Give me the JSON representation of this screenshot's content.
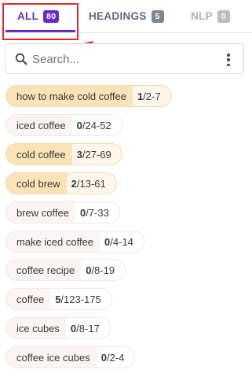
{
  "tabs": [
    {
      "label": "ALL",
      "count": "80"
    },
    {
      "label": "HEADINGS",
      "count": "5"
    },
    {
      "label": "NLP",
      "count": "0"
    }
  ],
  "search": {
    "placeholder": "Search..."
  },
  "keywords": [
    {
      "term": "how to make cold coffee",
      "used": "1",
      "range": "/2-7",
      "highlighted": true
    },
    {
      "term": "iced coffee",
      "used": "0",
      "range": "/24-52",
      "highlighted": false
    },
    {
      "term": "cold coffee",
      "used": "3",
      "range": "/27-69",
      "highlighted": true
    },
    {
      "term": "cold brew",
      "used": "2",
      "range": "/13-61",
      "highlighted": true
    },
    {
      "term": "brew coffee",
      "used": "0",
      "range": "/7-33",
      "highlighted": false
    },
    {
      "term": "make iced coffee",
      "used": "0",
      "range": "/4-14",
      "highlighted": false
    },
    {
      "term": "coffee recipe",
      "used": "0",
      "range": "/8-19",
      "highlighted": false
    },
    {
      "term": "coffee",
      "used": "5",
      "range": "/123-175",
      "highlighted": false
    },
    {
      "term": "ice cubes",
      "used": "0",
      "range": "/8-17",
      "highlighted": false
    },
    {
      "term": "coffee ice cubes",
      "used": "0",
      "range": "/2-4",
      "highlighted": false
    }
  ],
  "colors": {
    "accent": "#6a2cc4",
    "annotation": "#e02b2b",
    "chip_highlight": "#fbe3b8",
    "chip_default": "#fcf3f3"
  }
}
